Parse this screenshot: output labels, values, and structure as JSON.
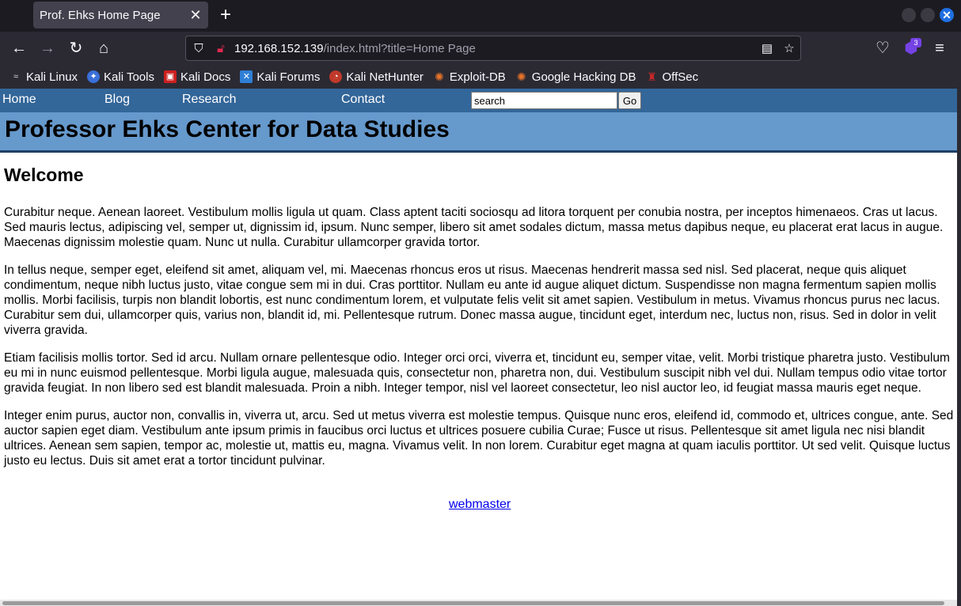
{
  "browser": {
    "tab_title": "Prof. Ehks Home Page",
    "url_host": "192.168.152.139",
    "url_path": "/index.html?title=Home Page",
    "extension_badge": "3",
    "bookmarks": [
      {
        "label": "Kali Linux",
        "icon": "kali-dragon-icon",
        "color": "#111111"
      },
      {
        "label": "Kali Tools",
        "icon": "kali-tools-icon",
        "color": "#3a6fd8"
      },
      {
        "label": "Kali Docs",
        "icon": "kali-docs-icon",
        "color": "#cc1f1f"
      },
      {
        "label": "Kali Forums",
        "icon": "kali-forums-icon",
        "color": "#2f7fd6"
      },
      {
        "label": "Kali NetHunter",
        "icon": "nethunter-icon",
        "color": "#c0392b"
      },
      {
        "label": "Exploit-DB",
        "icon": "exploit-db-icon",
        "color": "#e8732a"
      },
      {
        "label": "Google Hacking DB",
        "icon": "ghdb-icon",
        "color": "#e8732a"
      },
      {
        "label": "OffSec",
        "icon": "offsec-icon",
        "color": "#c62828"
      }
    ]
  },
  "site": {
    "nav": [
      "Home",
      "Blog",
      "Research",
      "Contact"
    ],
    "search_value": "search",
    "go_label": "Go",
    "banner_title": "Professor Ehks Center for Data Studies",
    "heading": "Welcome",
    "paragraphs": [
      "Curabitur neque. Aenean laoreet. Vestibulum mollis ligula ut quam. Class aptent taciti sociosqu ad litora torquent per conubia nostra, per inceptos himenaeos. Cras ut lacus. Sed mauris lectus, adipiscing vel, semper ut, dignissim id, ipsum. Nunc semper, libero sit amet sodales dictum, massa metus dapibus neque, eu placerat erat lacus in augue. Maecenas dignissim molestie quam. Nunc ut nulla. Curabitur ullamcorper gravida tortor.",
      "In tellus neque, semper eget, eleifend sit amet, aliquam vel, mi. Maecenas rhoncus eros ut risus. Maecenas hendrerit massa sed nisl. Sed placerat, neque quis aliquet condimentum, neque nibh luctus justo, vitae congue sem mi in dui. Cras porttitor. Nullam eu ante id augue aliquet dictum. Suspendisse non magna fermentum sapien mollis mollis. Morbi facilisis, turpis non blandit lobortis, est nunc condimentum lorem, et vulputate felis velit sit amet sapien. Vestibulum in metus. Vivamus rhoncus purus nec lacus. Curabitur sem dui, ullamcorper quis, varius non, blandit id, mi. Pellentesque rutrum. Donec massa augue, tincidunt eget, interdum nec, luctus non, risus. Sed in dolor in velit viverra gravida.",
      "Etiam facilisis mollis tortor. Sed id arcu. Nullam ornare pellentesque odio. Integer orci orci, viverra et, tincidunt eu, semper vitae, velit. Morbi tristique pharetra justo. Vestibulum eu mi in nunc euismod pellentesque. Morbi ligula augue, malesuada quis, consectetur non, pharetra non, dui. Vestibulum suscipit nibh vel dui. Nullam tempus odio vitae tortor gravida feugiat. In non libero sed est blandit malesuada. Proin a nibh. Integer tempor, nisl vel laoreet consectetur, leo nisl auctor leo, id feugiat massa mauris eget neque.",
      "Integer enim purus, auctor non, convallis in, viverra ut, arcu. Sed ut metus viverra est molestie tempus. Quisque nunc eros, eleifend id, commodo et, ultrices congue, ante. Sed auctor sapien eget diam. Vestibulum ante ipsum primis in faucibus orci luctus et ultrices posuere cubilia Curae; Fusce ut risus. Pellentesque sit amet ligula nec nisi blandit ultrices. Aenean sem sapien, tempor ac, molestie ut, mattis eu, magna. Vivamus velit. In non lorem. Curabitur eget magna at quam iaculis porttitor. Ut sed velit. Quisque luctus justo eu lectus. Duis sit amet erat a tortor tincidunt pulvinar."
    ],
    "footer_link": "webmaster"
  }
}
